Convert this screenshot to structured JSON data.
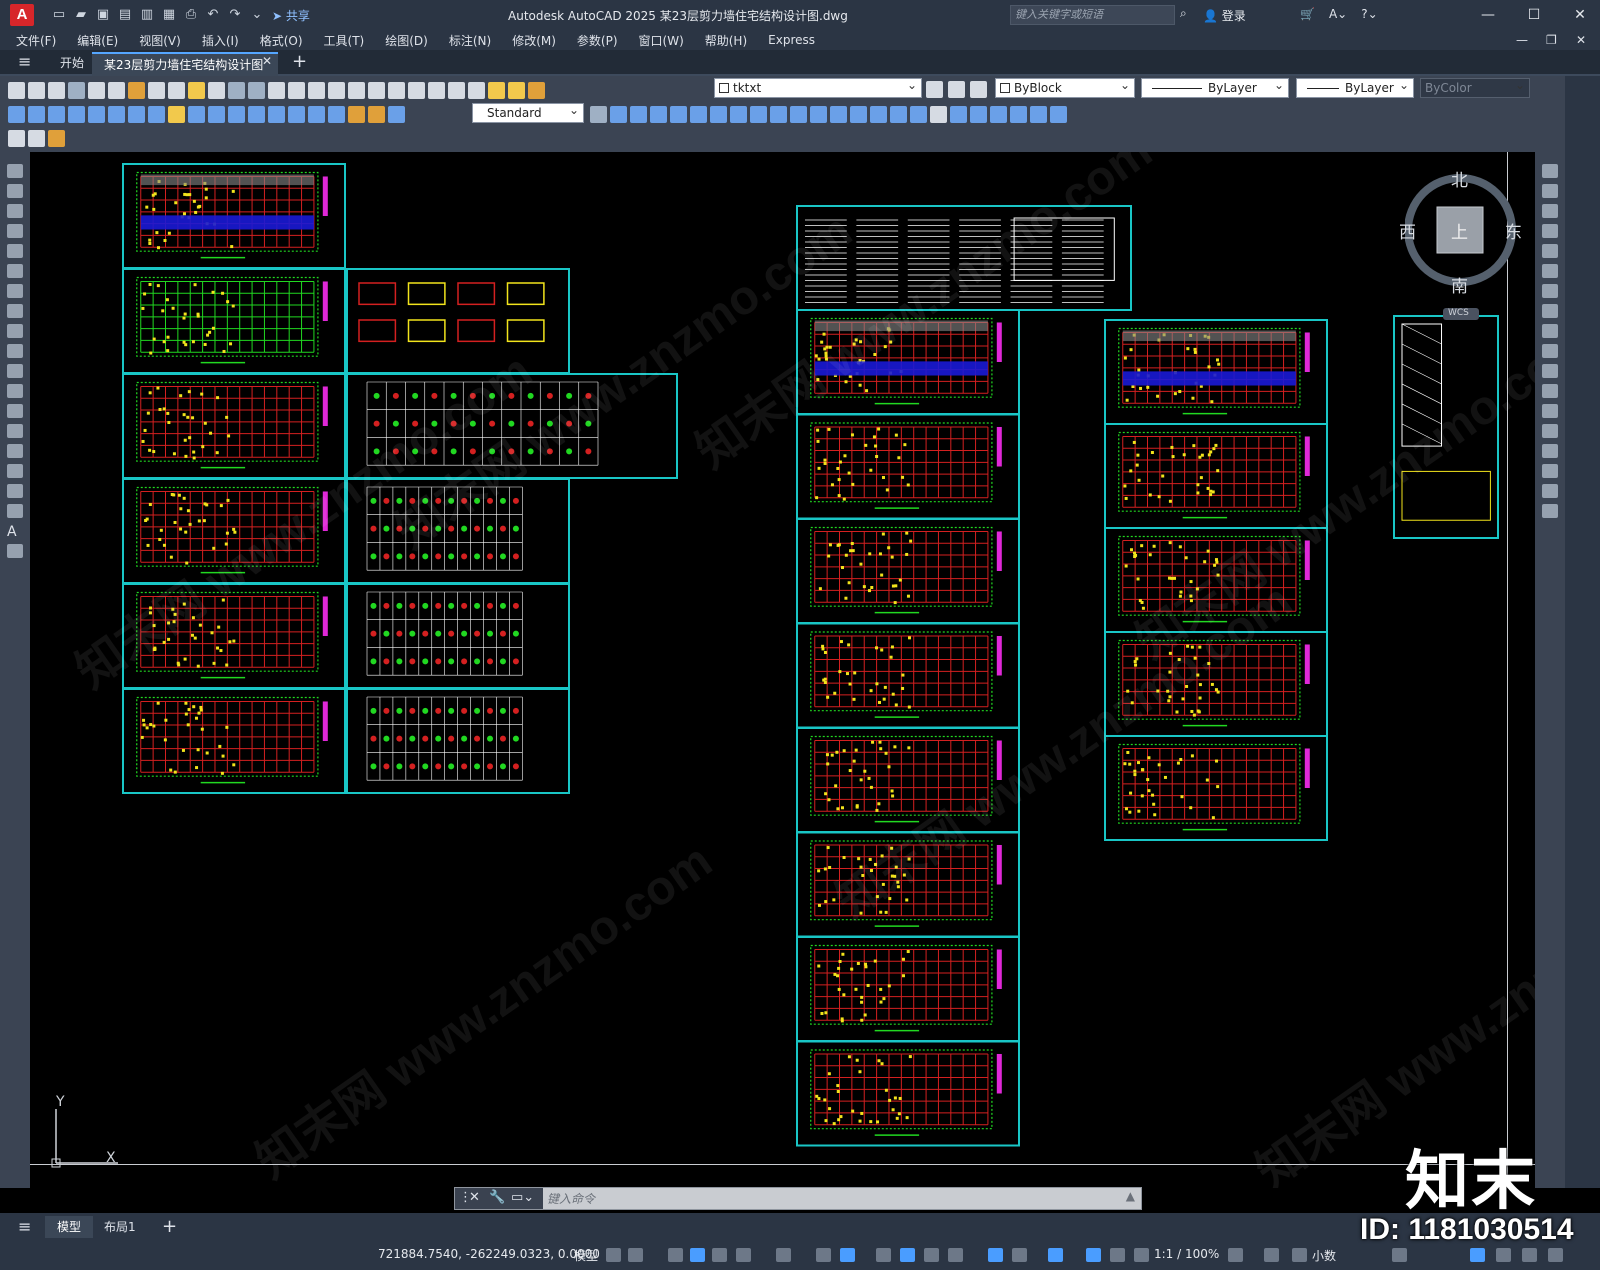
{
  "app": {
    "logo": "A",
    "title": "Autodesk AutoCAD 2025    某23层剪力墙住宅结构设计图.dwg",
    "share_label": "共享",
    "search_placeholder": "键入关键字或短语",
    "login_label": "登录"
  },
  "menu": [
    "文件(F)",
    "编辑(E)",
    "视图(V)",
    "插入(I)",
    "格式(O)",
    "工具(T)",
    "绘图(D)",
    "标注(N)",
    "修改(M)",
    "参数(P)",
    "窗口(W)",
    "帮助(H)",
    "Express"
  ],
  "file_tabs": {
    "start": "开始",
    "doc": "某23层剪力墙住宅结构设计图*",
    "add": "+"
  },
  "toolbar": {
    "layer": "tktxt",
    "color": "ByBlock",
    "linetype": "ByLayer",
    "lineweight": "ByLayer",
    "plotstyle": "ByColor",
    "text_style": "Standard"
  },
  "viewcube": {
    "north": "北",
    "south": "南",
    "east": "东",
    "west": "西",
    "top": "上",
    "wcs": "WCS"
  },
  "ucs": {
    "x": "X",
    "y": "Y"
  },
  "command": {
    "placeholder": "键入命令"
  },
  "layout_tabs": {
    "model": "模型",
    "layout1": "布局1",
    "add": "+"
  },
  "status": {
    "coords": "721884.7540, -262249.0323, 0.0000",
    "model": "模型",
    "scale": "1:1 / 100%",
    "units": "小数"
  },
  "brand": {
    "logo": "知末",
    "id": "ID: 1181030514"
  },
  "watermark_text": "知末网 www.znzmo.com",
  "colors": {
    "frame": "#19c6c6",
    "grid_red": "#d42020",
    "grid_green": "#21d821",
    "yellow": "#f2e41c",
    "magenta": "#e028d8",
    "accent": "#4a9dff"
  }
}
